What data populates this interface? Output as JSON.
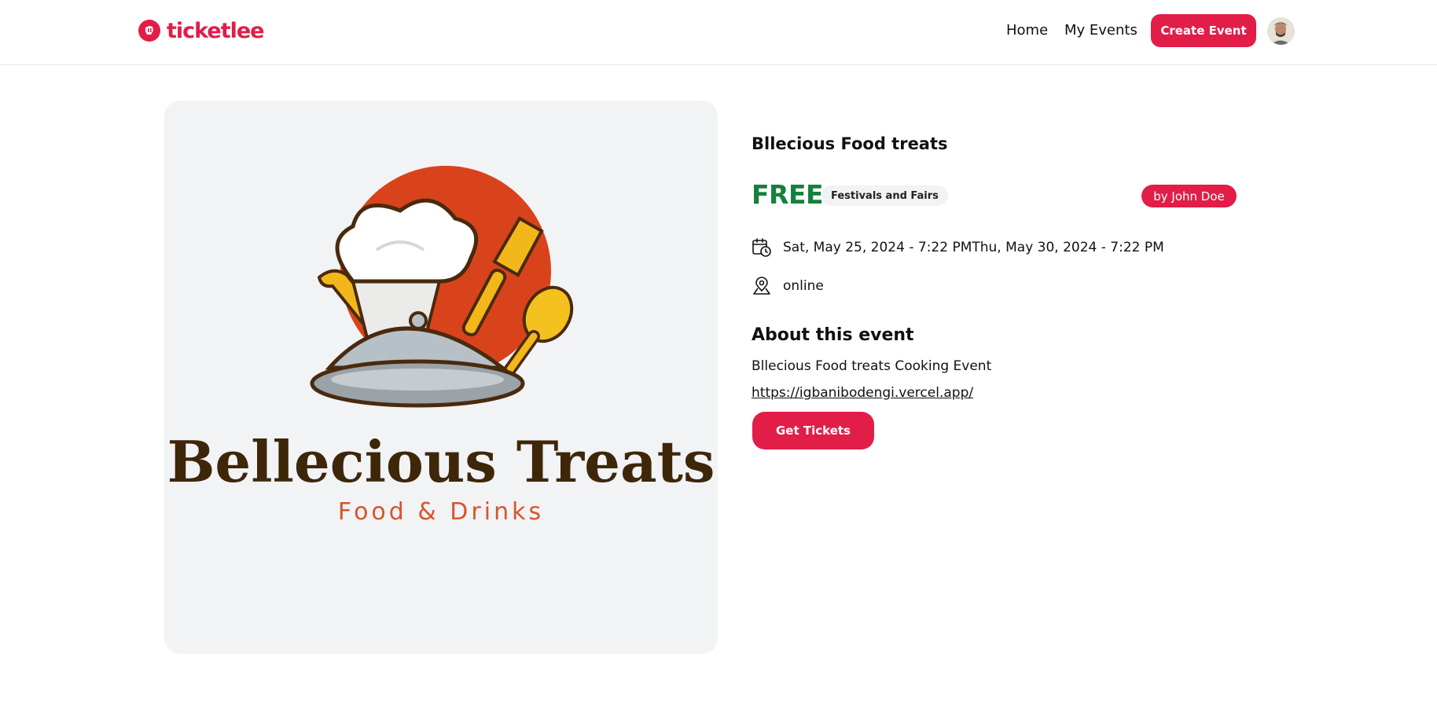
{
  "header": {
    "logo_text": "ticketlee",
    "logo_icon": "ticket-logo-icon",
    "nav": {
      "home": "Home",
      "my_events": "My Events",
      "create_event": "Create Event"
    },
    "avatar_icon": "user-avatar"
  },
  "event": {
    "image": {
      "brand_name": "Bellecious Treats",
      "tagline": "Food & Drinks"
    },
    "title": "Bllecious Food treats",
    "price": "FREE",
    "category": "Festivals and Fairs",
    "organizer": "by John Doe",
    "date_range": "Sat, May 25, 2024 - 7:22 PMThu, May 30, 2024 - 7:22 PM",
    "date_icon": "calendar-clock-icon",
    "location": "online",
    "location_icon": "map-pin-icon",
    "about_heading": "About this event",
    "description": "Bllecious Food treats Cooking Event",
    "link": "https://igbanibodengi.vercel.app/",
    "get_tickets": "Get Tickets"
  },
  "colors": {
    "brand": "#e11d48",
    "price_green": "#15803d",
    "image_bg": "#f1f3f5"
  }
}
